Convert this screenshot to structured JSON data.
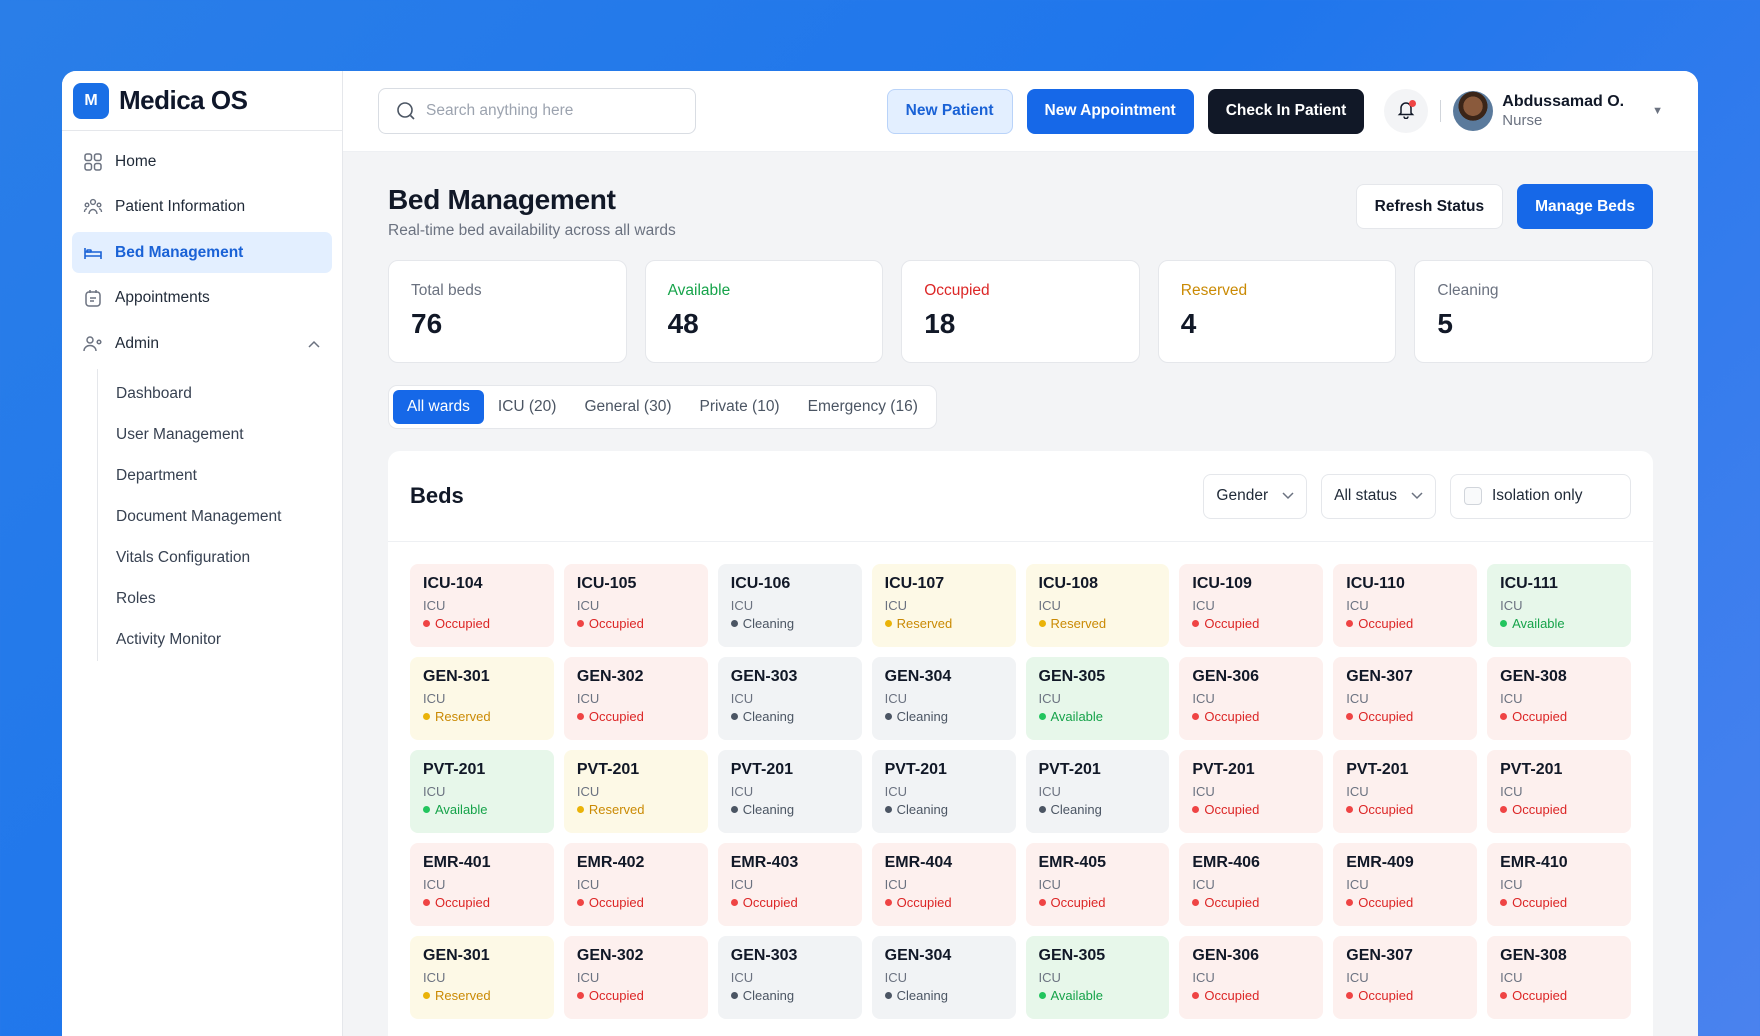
{
  "app": {
    "logo_letter": "M",
    "name": "Medica OS"
  },
  "sidebar": {
    "items": [
      {
        "label": "Home",
        "icon": "grid-icon"
      },
      {
        "label": "Patient Information",
        "icon": "patients-icon"
      },
      {
        "label": "Bed Management",
        "icon": "bed-icon",
        "active": true
      },
      {
        "label": "Appointments",
        "icon": "calendar-icon"
      },
      {
        "label": "Admin",
        "icon": "admin-icon",
        "expanded": true
      }
    ],
    "admin_sub": [
      "Dashboard",
      "User Management",
      "Department",
      "Document Management",
      "Vitals Configuration",
      "Roles",
      "Activity Monitor"
    ]
  },
  "topbar": {
    "search_placeholder": "Search anything here",
    "new_patient": "New Patient",
    "new_appointment": "New Appointment",
    "check_in": "Check In Patient",
    "user_name": "Abdussamad O.",
    "user_role": "Nurse"
  },
  "page": {
    "title": "Bed Management",
    "subtitle": "Real-time bed availability across all wards",
    "refresh": "Refresh Status",
    "manage": "Manage Beds"
  },
  "stats": [
    {
      "label": "Total beds",
      "value": "76",
      "color": "#6b7280"
    },
    {
      "label": "Available",
      "value": "48",
      "color": "#16a34a"
    },
    {
      "label": "Occupied",
      "value": "18",
      "color": "#dc2626"
    },
    {
      "label": "Reserved",
      "value": "4",
      "color": "#ca8a04"
    },
    {
      "label": "Cleaning",
      "value": "5",
      "color": "#6b7280"
    }
  ],
  "tabs": [
    "All wards",
    "ICU (20)",
    "General (30)",
    "Private (10)",
    "Emergency (16)"
  ],
  "beds_panel": {
    "title": "Beds",
    "gender_filter": "Gender",
    "status_filter": "All status",
    "isolation": "Isolation only"
  },
  "beds": [
    {
      "id": "ICU-104",
      "ward": "ICU",
      "status": "Occupied"
    },
    {
      "id": "ICU-105",
      "ward": "ICU",
      "status": "Occupied"
    },
    {
      "id": "ICU-106",
      "ward": "ICU",
      "status": "Cleaning"
    },
    {
      "id": "ICU-107",
      "ward": "ICU",
      "status": "Reserved"
    },
    {
      "id": "ICU-108",
      "ward": "ICU",
      "status": "Reserved"
    },
    {
      "id": "ICU-109",
      "ward": "ICU",
      "status": "Occupied"
    },
    {
      "id": "ICU-110",
      "ward": "ICU",
      "status": "Occupied"
    },
    {
      "id": "ICU-111",
      "ward": "ICU",
      "status": "Available"
    },
    {
      "id": "GEN-301",
      "ward": "ICU",
      "status": "Reserved"
    },
    {
      "id": "GEN-302",
      "ward": "ICU",
      "status": "Occupied"
    },
    {
      "id": "GEN-303",
      "ward": "ICU",
      "status": "Cleaning"
    },
    {
      "id": "GEN-304",
      "ward": "ICU",
      "status": "Cleaning"
    },
    {
      "id": "GEN-305",
      "ward": "ICU",
      "status": "Available"
    },
    {
      "id": "GEN-306",
      "ward": "ICU",
      "status": "Occupied"
    },
    {
      "id": "GEN-307",
      "ward": "ICU",
      "status": "Occupied"
    },
    {
      "id": "GEN-308",
      "ward": "ICU",
      "status": "Occupied"
    },
    {
      "id": "PVT-201",
      "ward": "ICU",
      "status": "Available"
    },
    {
      "id": "PVT-201",
      "ward": "ICU",
      "status": "Reserved"
    },
    {
      "id": "PVT-201",
      "ward": "ICU",
      "status": "Cleaning"
    },
    {
      "id": "PVT-201",
      "ward": "ICU",
      "status": "Cleaning"
    },
    {
      "id": "PVT-201",
      "ward": "ICU",
      "status": "Cleaning"
    },
    {
      "id": "PVT-201",
      "ward": "ICU",
      "status": "Occupied"
    },
    {
      "id": "PVT-201",
      "ward": "ICU",
      "status": "Occupied"
    },
    {
      "id": "PVT-201",
      "ward": "ICU",
      "status": "Occupied"
    },
    {
      "id": "EMR-401",
      "ward": "ICU",
      "status": "Occupied"
    },
    {
      "id": "EMR-402",
      "ward": "ICU",
      "status": "Occupied"
    },
    {
      "id": "EMR-403",
      "ward": "ICU",
      "status": "Occupied"
    },
    {
      "id": "EMR-404",
      "ward": "ICU",
      "status": "Occupied"
    },
    {
      "id": "EMR-405",
      "ward": "ICU",
      "status": "Occupied"
    },
    {
      "id": "EMR-406",
      "ward": "ICU",
      "status": "Occupied"
    },
    {
      "id": "EMR-409",
      "ward": "ICU",
      "status": "Occupied"
    },
    {
      "id": "EMR-410",
      "ward": "ICU",
      "status": "Occupied"
    },
    {
      "id": "GEN-301",
      "ward": "ICU",
      "status": "Reserved"
    },
    {
      "id": "GEN-302",
      "ward": "ICU",
      "status": "Occupied"
    },
    {
      "id": "GEN-303",
      "ward": "ICU",
      "status": "Cleaning"
    },
    {
      "id": "GEN-304",
      "ward": "ICU",
      "status": "Cleaning"
    },
    {
      "id": "GEN-305",
      "ward": "ICU",
      "status": "Available"
    },
    {
      "id": "GEN-306",
      "ward": "ICU",
      "status": "Occupied"
    },
    {
      "id": "GEN-307",
      "ward": "ICU",
      "status": "Occupied"
    },
    {
      "id": "GEN-308",
      "ward": "ICU",
      "status": "Occupied"
    }
  ]
}
